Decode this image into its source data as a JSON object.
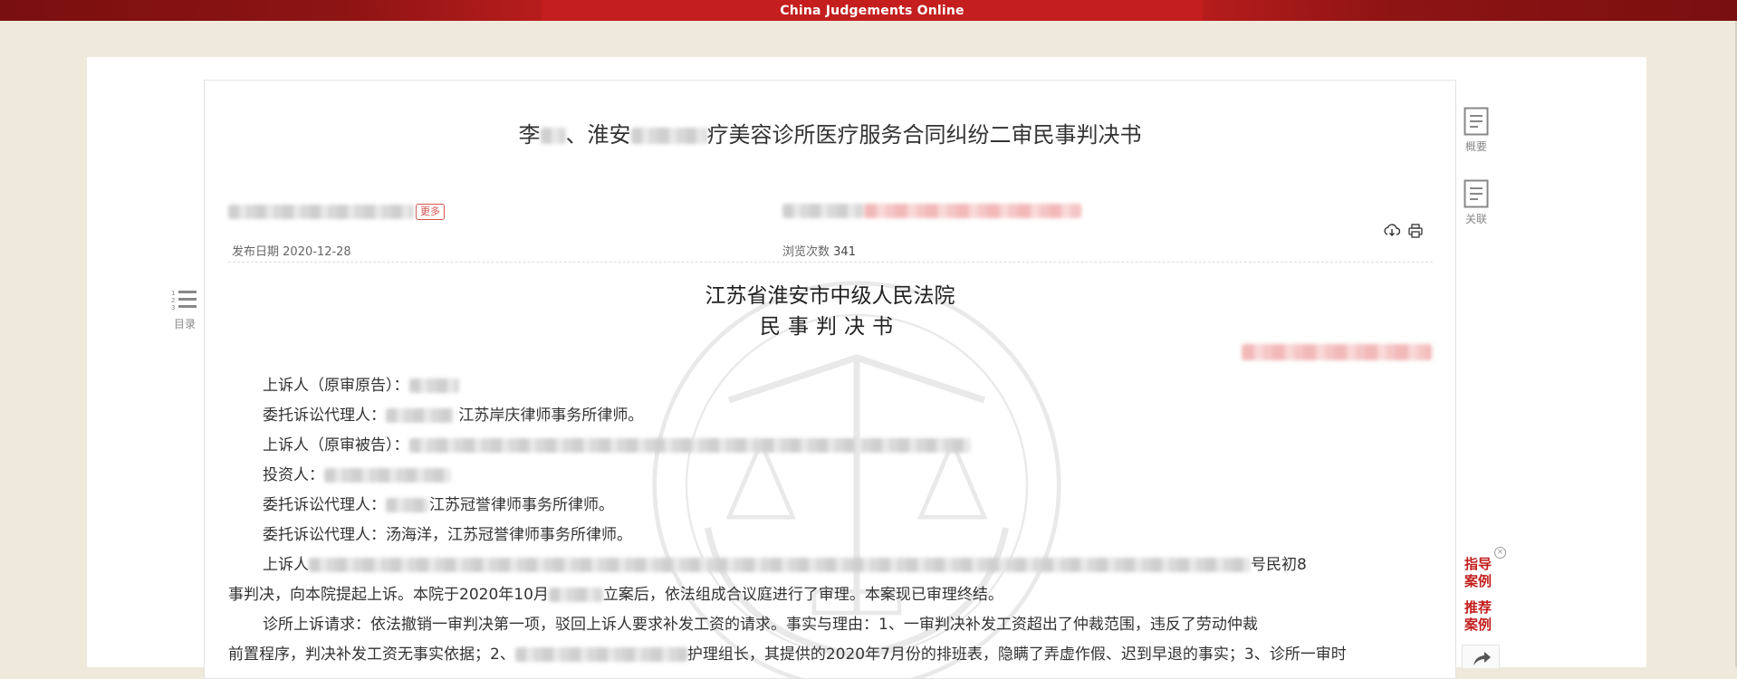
{
  "header": {
    "site_name": "China Judgements Online"
  },
  "document": {
    "title_parts": [
      "李",
      "、淮安",
      "疗美容诊所医疗服务合同纠纷二审民事判决书"
    ],
    "more_link": "更多",
    "publish_label": "发布日期",
    "publish_value": "2020-12-28",
    "views_label": "浏览次数",
    "views_value": "341",
    "court_name": "江苏省淮安市中级人民法院",
    "doc_type": "民事判决书"
  },
  "body": {
    "paragraphs": [
      {
        "lead": "上诉人（原审原告）：",
        "tail": ""
      },
      {
        "lead": "委托诉讼代理人：",
        "tail": "江苏岸庆律师事务所律师。"
      },
      {
        "lead": "上诉人（原审被告）：",
        "tail": ""
      },
      {
        "lead": "投资人：",
        "tail": ""
      },
      {
        "lead": "委托诉讼代理人：",
        "tail": "江苏冠誉律师事务所律师。"
      },
      {
        "lead": "委托诉讼代理人：",
        "tail": "汤海洋，江苏冠誉律师事务所律师。"
      }
    ],
    "para7_a": "上诉人",
    "para7_b": "号民初8",
    "para7_c": "事判决，向本院提起上诉。本院于2020年10月",
    "para7_d": "立案后，依法组成合议庭进行了审理。本案现已审理终结。",
    "para8_a": "诊所上诉请求：依法撤销一审判决第一项，驳回上诉人要求补发工资的请求。事实与理由：1、一审判决补发工资超出了仲裁范围，违反了劳动仲裁",
    "para8_b": "前置程序，判决补发工资无事实依据；2、",
    "para8_c": "护理组长，其提供的2020年7月份的排班表，隐瞒了弄虚作假、迟到早退的事实；3、诊所一审时"
  },
  "sidebar": {
    "toc_label": "目录",
    "summary_label": "概要",
    "related_label": "关联",
    "guide_case": "指导案例",
    "recommend_case": "推荐案例",
    "close_glyph": "×"
  },
  "colors": {
    "brand_red": "#c41e1e",
    "background": "#efe9dc"
  }
}
